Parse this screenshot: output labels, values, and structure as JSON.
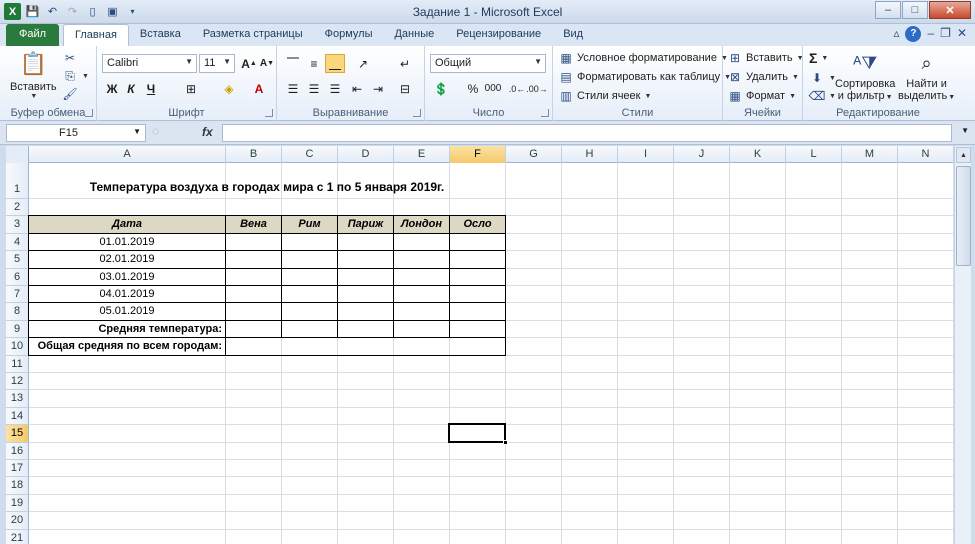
{
  "window": {
    "title": "Задание 1  -  Microsoft Excel",
    "app_icon": "X",
    "minimize": "–",
    "maximize": "□",
    "close": "✕"
  },
  "tabs": [
    {
      "label": "Файл"
    },
    {
      "label": "Главная"
    },
    {
      "label": "Вставка"
    },
    {
      "label": "Разметка страницы"
    },
    {
      "label": "Формулы"
    },
    {
      "label": "Данные"
    },
    {
      "label": "Рецензирование"
    },
    {
      "label": "Вид"
    }
  ],
  "ribbon": {
    "clipboard": {
      "label": "Буфер обмена",
      "paste": "Вставить"
    },
    "font": {
      "label": "Шрифт",
      "name": "Calibri",
      "size": "11",
      "bold": "Ж",
      "italic": "К",
      "underline": "Ч"
    },
    "alignment": {
      "label": "Выравнивание"
    },
    "number": {
      "label": "Число",
      "format": "Общий",
      "percent": "%",
      "thousands": "000"
    },
    "styles": {
      "label": "Стили",
      "conditional": "Условное форматирование",
      "as_table": "Форматировать как таблицу",
      "cell_styles": "Стили ячеек"
    },
    "cells": {
      "label": "Ячейки",
      "insert": "Вставить",
      "delete": "Удалить",
      "format": "Формат"
    },
    "editing": {
      "label": "Редактирование",
      "sort": "Сортировка и фильтр",
      "sort_line1": "Сортировка",
      "sort_line2": "и фильтр",
      "find": "Найти и выделить",
      "find_line1": "Найти и",
      "find_line2": "выделить",
      "sum": "Σ"
    }
  },
  "formula_bar": {
    "name_box": "F15",
    "fx": "fx",
    "formula": ""
  },
  "columns": [
    "A",
    "B",
    "C",
    "D",
    "E",
    "F",
    "G",
    "H",
    "I",
    "J",
    "K",
    "L",
    "M",
    "N"
  ],
  "rows": [
    "1",
    "2",
    "3",
    "4",
    "5",
    "6",
    "7",
    "8",
    "9",
    "10",
    "11",
    "12",
    "13",
    "14",
    "15",
    "16",
    "17",
    "18",
    "19",
    "20",
    "21"
  ],
  "selected": {
    "column": "F",
    "row": "15"
  },
  "sheet": {
    "title": "Температура воздуха в городах мира с 1 по 5 января 2019г.",
    "header": [
      "Дата",
      "Вена",
      "Рим",
      "Париж",
      "Лондон",
      "Осло"
    ],
    "dates": [
      "01.01.2019",
      "02.01.2019",
      "03.01.2019",
      "04.01.2019",
      "05.01.2019"
    ],
    "avg_label": "Средняя температура:",
    "total_label": "Общая средняя по всем городам:"
  }
}
